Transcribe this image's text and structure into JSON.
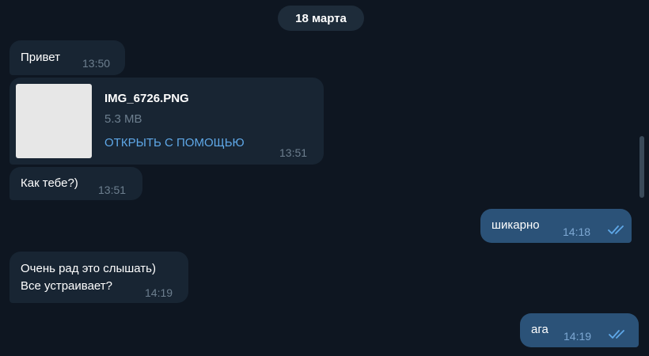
{
  "date_divider": "18 марта",
  "messages": [
    {
      "type": "text",
      "direction": "incoming",
      "text": "Привет",
      "time": "13:50"
    },
    {
      "type": "file",
      "direction": "incoming",
      "file_name": "IMG_6726.PNG",
      "file_size": "5.3 MB",
      "action_label": "ОТКРЫТЬ С ПОМОЩЬЮ",
      "time": "13:51"
    },
    {
      "type": "text",
      "direction": "incoming",
      "text": "Как тебе?)",
      "time": "13:51"
    },
    {
      "type": "text",
      "direction": "outgoing",
      "text": "шикарно",
      "time": "14:18",
      "status": "read"
    },
    {
      "type": "text",
      "direction": "incoming",
      "lines": [
        "Очень рад это слышать)",
        "Все устраивает?"
      ],
      "time": "14:19"
    },
    {
      "type": "text",
      "direction": "outgoing",
      "text": "ага",
      "time": "14:19",
      "status": "read"
    }
  ],
  "colors": {
    "background": "#0e1621",
    "incoming_bubble": "#182533",
    "outgoing_bubble": "#2b5278",
    "link": "#5fa8e8",
    "read_checks": "#5fa8e8"
  },
  "icons": {
    "read_status": "double-check-icon"
  }
}
